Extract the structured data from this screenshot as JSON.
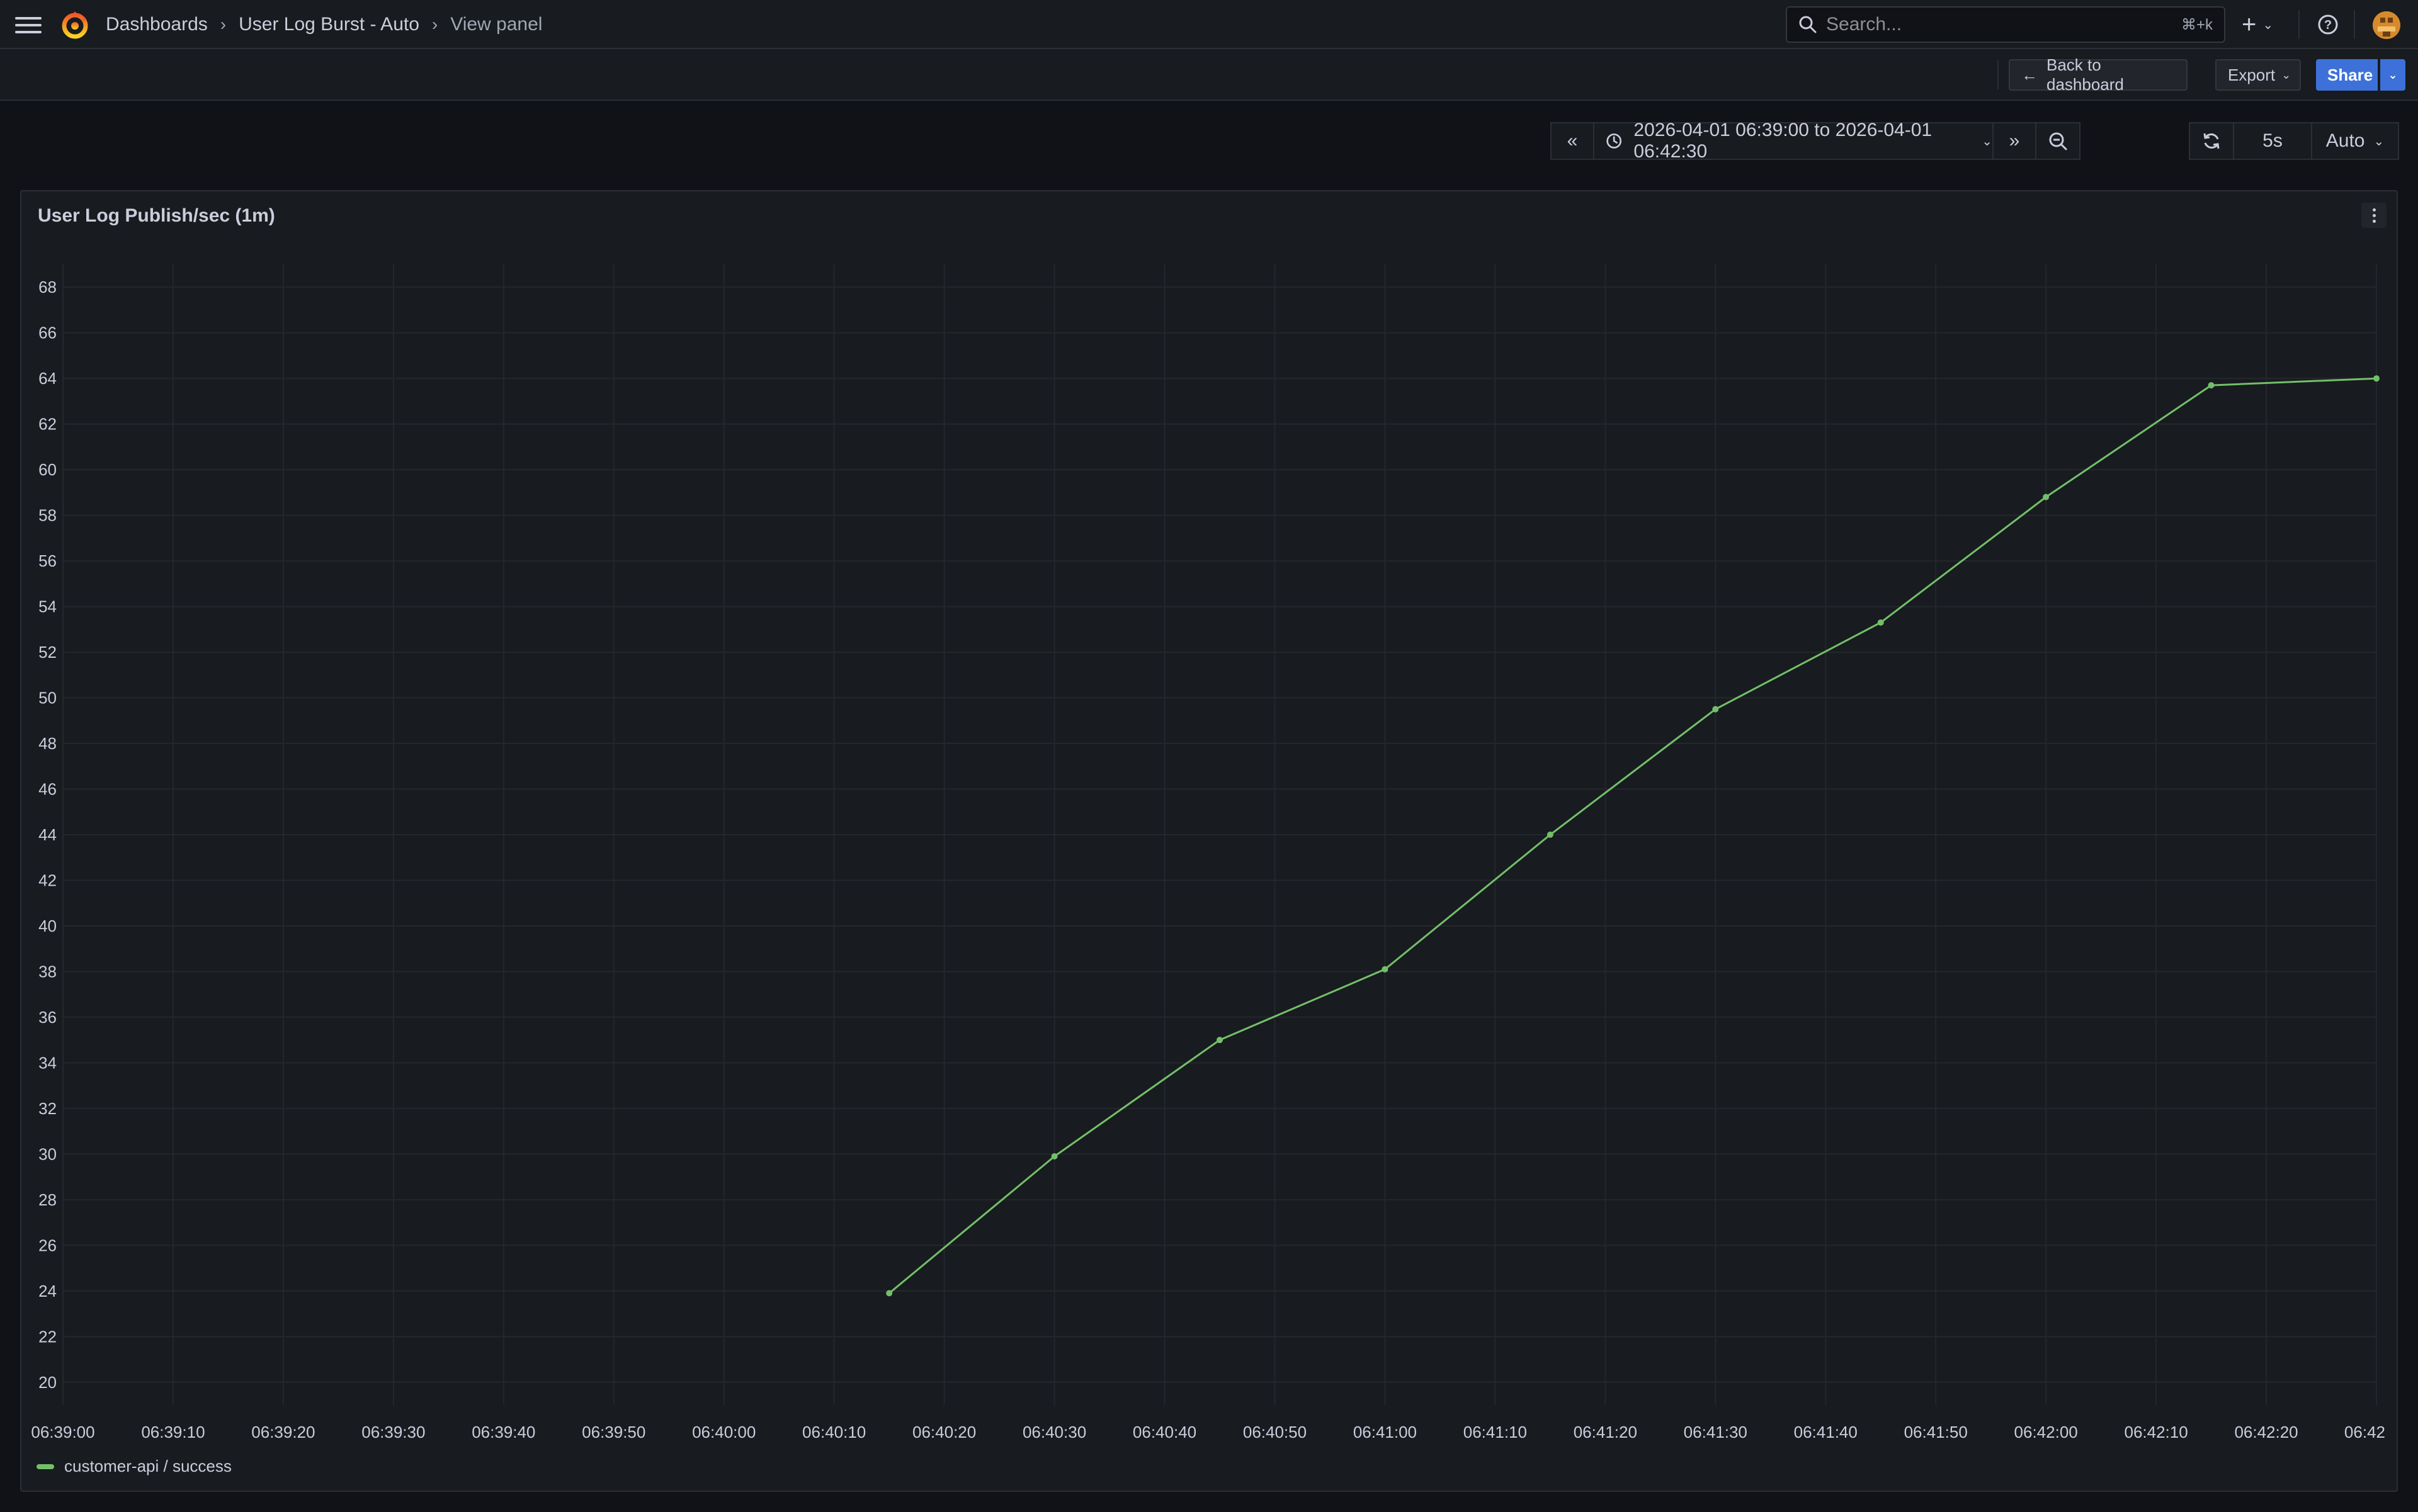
{
  "topbar": {
    "breadcrumbs": [
      "Dashboards",
      "User Log Burst - Auto",
      "View panel"
    ],
    "search_placeholder": "Search...",
    "search_shortcut": "⌘+k",
    "add_label": "+"
  },
  "toolbar": {
    "back_label": "Back to dashboard",
    "export_label": "Export",
    "share_label": "Share"
  },
  "timepicker": {
    "range_label": "2026-04-01 06:39:00 to 2026-04-01 06:42:30",
    "refresh_interval": "5s",
    "refresh_mode": "Auto"
  },
  "panel": {
    "title": "User Log Publish/sec (1m)"
  },
  "colors": {
    "series": "#73bf69",
    "accent": "#3d71d9"
  },
  "chart_data": {
    "type": "line",
    "x_tick_labels": [
      "06:39:00",
      "06:39:10",
      "06:39:20",
      "06:39:30",
      "06:39:40",
      "06:39:50",
      "06:40:00",
      "06:40:10",
      "06:40:20",
      "06:40:30",
      "06:40:40",
      "06:40:50",
      "06:41:00",
      "06:41:10",
      "06:41:20",
      "06:41:30",
      "06:41:40",
      "06:41:50",
      "06:42:00",
      "06:42:10",
      "06:42:20",
      "06:42"
    ],
    "y_ticks": [
      20,
      22,
      24,
      26,
      28,
      30,
      32,
      34,
      36,
      38,
      40,
      42,
      44,
      46,
      48,
      50,
      52,
      54,
      56,
      58,
      60,
      62,
      64,
      66,
      68
    ],
    "xlim": [
      "06:39:00",
      "06:42:30"
    ],
    "ylim": [
      19,
      69
    ],
    "series": [
      {
        "name": "customer-api / success",
        "x": [
          "06:40:15",
          "06:40:30",
          "06:40:45",
          "06:41:00",
          "06:41:15",
          "06:41:30",
          "06:41:45",
          "06:42:00",
          "06:42:15",
          "06:42:30"
        ],
        "values": [
          23.9,
          29.9,
          35.0,
          38.1,
          44.0,
          49.5,
          53.3,
          58.8,
          63.7,
          64.0
        ]
      }
    ],
    "legend_position": "bottom-left",
    "grid": true
  }
}
